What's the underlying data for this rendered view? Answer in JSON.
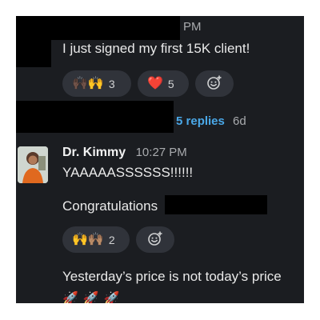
{
  "message1": {
    "time": "PM",
    "text": "I just signed my first 15K client!",
    "reactions": [
      {
        "emoji": "🙌🏿🙌",
        "count": "3"
      },
      {
        "emoji": "❤️",
        "count": "5"
      }
    ],
    "add_reaction_icon": "smiley-plus-icon"
  },
  "thread": {
    "replies_label": "5 replies",
    "ago": "6d"
  },
  "message2": {
    "sender": "Dr. Kimmy",
    "time": "10:27 PM",
    "line1": "YAAAAASSSSSS!!!!!!",
    "line2": "Congratulations",
    "reactions": [
      {
        "emoji": "🙌🙌🏽",
        "count": "2"
      }
    ],
    "add_reaction_icon": "smiley-plus-icon",
    "line3": "Yesterday’s price is not today’s price",
    "emoji_line": "🚀🚀🚀"
  },
  "colors": {
    "background": "#1b1d21",
    "link": "#4aa8e8",
    "pill": "#30333a",
    "muted": "#a9abae"
  }
}
